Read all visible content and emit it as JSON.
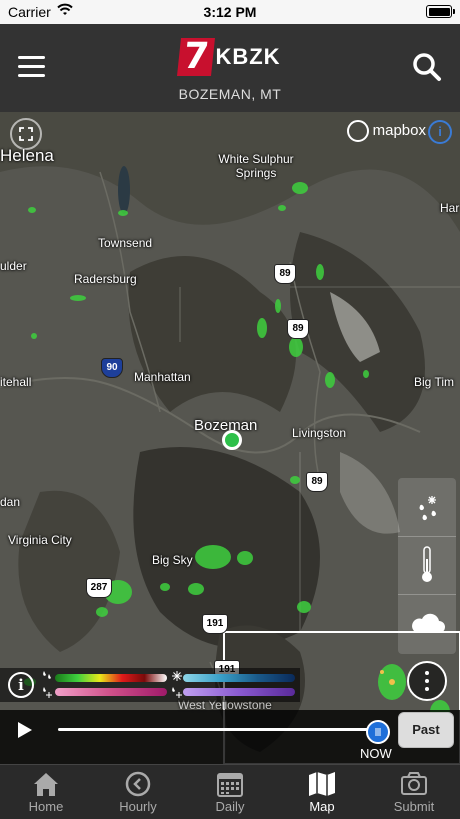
{
  "status_bar": {
    "carrier": "Carrier",
    "time": "3:12 PM"
  },
  "header": {
    "logo_numeral": "7",
    "logo_letters": "KBZK",
    "location": "BOZEMAN, MT"
  },
  "map": {
    "attribution": "mapbox",
    "info_letter": "i",
    "place_labels": [
      "Helena",
      "White Sulphur Springs",
      "Townsend",
      "Radersburg",
      "Manhattan",
      "Bozeman",
      "Livingston",
      "Virginia City",
      "Big Sky",
      "West Yellowstone",
      "Big Tim",
      "ulder",
      "itehall",
      "dan",
      "Har"
    ],
    "highway_shields": [
      "89",
      "89",
      "90",
      "89",
      "287",
      "191",
      "191"
    ]
  },
  "legend": {
    "info_letter": "i"
  },
  "timeline": {
    "now_label": "NOW",
    "past_button": "Past"
  },
  "tabs": [
    {
      "label": "Home",
      "icon": "house-icon"
    },
    {
      "label": "Hourly",
      "icon": "clock-icon"
    },
    {
      "label": "Daily",
      "icon": "calendar-icon"
    },
    {
      "label": "Map",
      "icon": "map-icon"
    },
    {
      "label": "Submit",
      "icon": "camera-icon"
    }
  ],
  "colors": {
    "header_bg": "#333333",
    "accent_blue": "#1e6fd9",
    "location_marker": "#2ec04a",
    "logo_red": "#c8102e",
    "precip_green": "#3ecf3e"
  }
}
